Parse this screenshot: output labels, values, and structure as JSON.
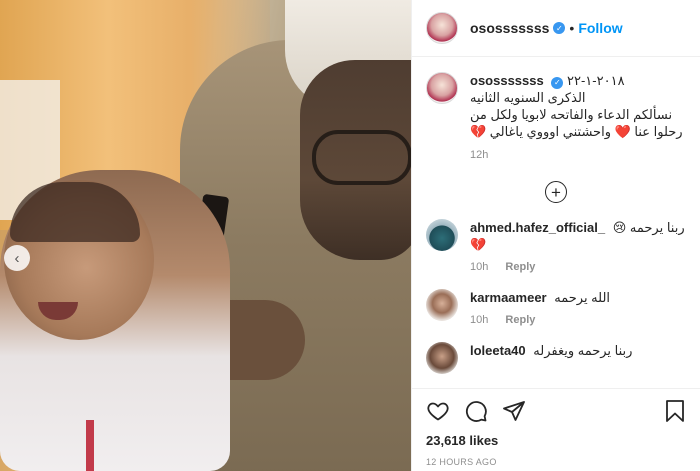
{
  "post": {
    "username": "ososssssss",
    "follow_label": "Follow",
    "separator": "•",
    "carousel_prev_glyph": "‹"
  },
  "caption": {
    "username": "ososssssss",
    "date": "٢٠١٨-١-٢٢",
    "line1": "الذكرى السنويه الثانيه",
    "line2": "نسألكم الدعاء والفاتحه لابويا ولكل من",
    "line3": "رحلوا عنا ❤️ واحشتني اوووي ياغالي 💔",
    "time": "12h"
  },
  "comments": [
    {
      "username": "ahmed.hafez_official_",
      "text": "ربنا يرحمه 😢💔",
      "time": "10h",
      "reply": "Reply"
    },
    {
      "username": "karmaameer",
      "text": "الله يرحمه",
      "time": "10h",
      "reply": "Reply"
    },
    {
      "username": "loleeta40",
      "text": "ربنا يرحمه ويغفرله"
    }
  ],
  "footer": {
    "likes": "23,618 likes",
    "time_ago": "12 HOURS AGO"
  },
  "icons": [
    "heart-icon",
    "comment-icon",
    "share-icon",
    "bookmark-icon",
    "plus-circle-icon",
    "verified-badge-icon",
    "chevron-left-icon"
  ],
  "colors": {
    "follow": "#0095f6",
    "verified": "#3897f0",
    "muted": "#8e8e8e"
  }
}
